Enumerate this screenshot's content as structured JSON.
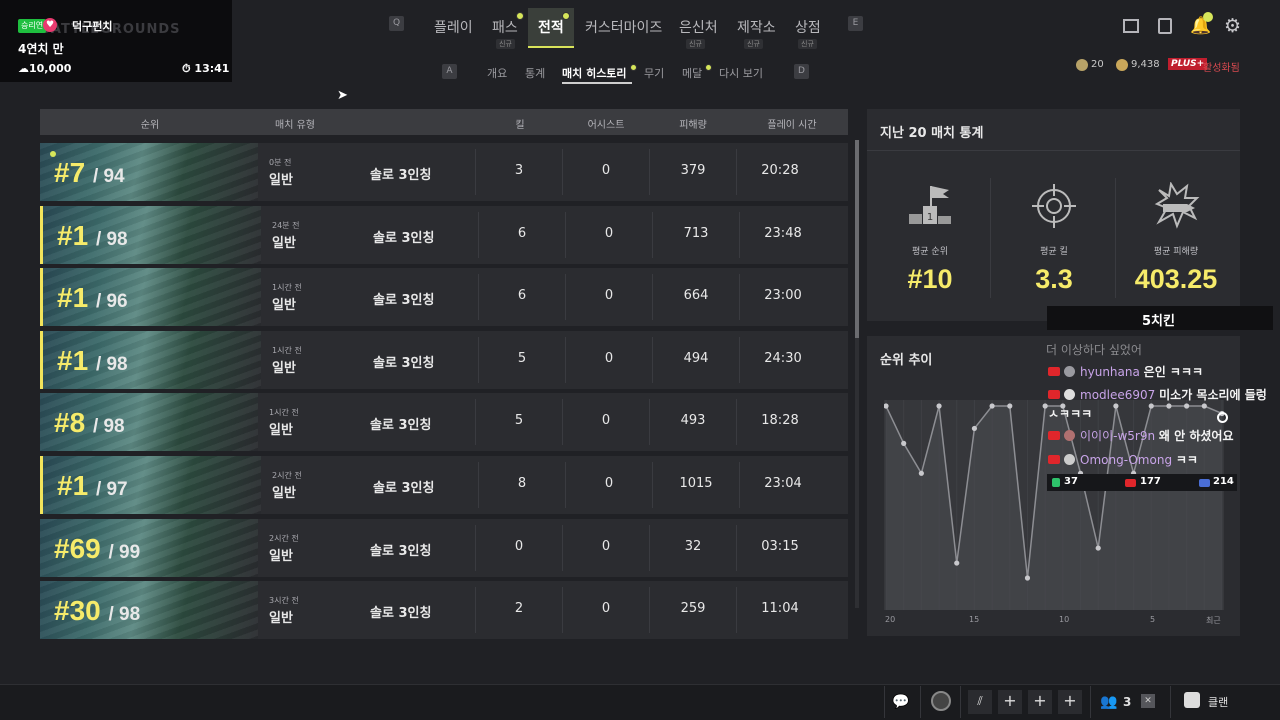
{
  "overlay": {
    "tag": "승리연",
    "name": "덕구펀치",
    "logo": "BATTLEGROUNDS",
    "goal": "4연치 만",
    "amount": "10,000",
    "time": "13:41"
  },
  "nav": {
    "key_left": "Q",
    "key_right": "E",
    "items": [
      {
        "label": "플레이",
        "new": ""
      },
      {
        "label": "패스",
        "new": "신규"
      },
      {
        "label": "전적",
        "new": ""
      },
      {
        "label": "커스터마이즈",
        "new": ""
      },
      {
        "label": "은신처",
        "new": "신규"
      },
      {
        "label": "제작소",
        "new": "신규"
      },
      {
        "label": "상점",
        "new": "신규"
      }
    ]
  },
  "currency": {
    "coins": "20",
    "bp": "9,438",
    "plus_badge": "PLUS+",
    "plus_status": "활성화됨"
  },
  "subnav": {
    "key_left": "A",
    "key_right": "D",
    "items": [
      "개요",
      "통계",
      "매치 히스토리",
      "무기",
      "메달",
      "다시 보기"
    ],
    "active": "매치 히스토리"
  },
  "table": {
    "headers": {
      "rank": "순위",
      "type": "매치 유형",
      "kills": "킬",
      "assists": "어시스트",
      "damage": "피해량",
      "playtime": "플레이 시간"
    },
    "rows": [
      {
        "rank": "#7",
        "total": "/ 94",
        "ago": "0분 전",
        "type": "일반",
        "mode": "솔로 3인칭",
        "kills": "3",
        "assists": "0",
        "damage": "379",
        "time": "20:28",
        "win": false,
        "new": true
      },
      {
        "rank": "#1",
        "total": "/ 98",
        "ago": "24분 전",
        "type": "일반",
        "mode": "솔로 3인칭",
        "kills": "6",
        "assists": "0",
        "damage": "713",
        "time": "23:48",
        "win": true,
        "new": false
      },
      {
        "rank": "#1",
        "total": "/ 96",
        "ago": "1시간 전",
        "type": "일반",
        "mode": "솔로 3인칭",
        "kills": "6",
        "assists": "0",
        "damage": "664",
        "time": "23:00",
        "win": true,
        "new": false
      },
      {
        "rank": "#1",
        "total": "/ 98",
        "ago": "1시간 전",
        "type": "일반",
        "mode": "솔로 3인칭",
        "kills": "5",
        "assists": "0",
        "damage": "494",
        "time": "24:30",
        "win": true,
        "new": false
      },
      {
        "rank": "#8",
        "total": "/ 98",
        "ago": "1시간 전",
        "type": "일반",
        "mode": "솔로 3인칭",
        "kills": "5",
        "assists": "0",
        "damage": "493",
        "time": "18:28",
        "win": false,
        "new": false
      },
      {
        "rank": "#1",
        "total": "/ 97",
        "ago": "2시간 전",
        "type": "일반",
        "mode": "솔로 3인칭",
        "kills": "8",
        "assists": "0",
        "damage": "1015",
        "time": "23:04",
        "win": true,
        "new": false
      },
      {
        "rank": "#69",
        "total": "/ 99",
        "ago": "2시간 전",
        "type": "일반",
        "mode": "솔로 3인칭",
        "kills": "0",
        "assists": "0",
        "damage": "32",
        "time": "03:15",
        "win": false,
        "new": false
      },
      {
        "rank": "#30",
        "total": "/ 98",
        "ago": "3시간 전",
        "type": "일반",
        "mode": "솔로 3인칭",
        "kills": "2",
        "assists": "0",
        "damage": "259",
        "time": "11:04",
        "win": false,
        "new": false
      }
    ]
  },
  "stats": {
    "title": "지난 20 매치 통계",
    "avg_rank_label": "평균 순위",
    "avg_rank": "#10",
    "avg_kills_label": "평균 킬",
    "avg_kills": "3.3",
    "avg_damage_label": "평균 피해량",
    "avg_damage": "403.25"
  },
  "trend": {
    "title": "순위 추이",
    "xticks": [
      "20",
      "15",
      "10",
      "5",
      "최근"
    ]
  },
  "chart_data": {
    "type": "line",
    "title": "순위 추이",
    "x": [
      20,
      19,
      18,
      17,
      16,
      15,
      14,
      13,
      12,
      11,
      10,
      9,
      8,
      7,
      6,
      5,
      4,
      3,
      2,
      1
    ],
    "series": [
      {
        "values": [
          1,
          6,
          10,
          1,
          22,
          4,
          1,
          1,
          24,
          1,
          1,
          10,
          20,
          1,
          10,
          1,
          1,
          1,
          1,
          2
        ]
      }
    ],
    "ylim": [
      1,
      24
    ],
    "grid": true
  },
  "chat": {
    "top_label": "5치킨",
    "partial": "더 이상하다 싶었어",
    "lines": [
      {
        "user": "hyunhana",
        "msg": "은인 ㅋㅋㅋ"
      },
      {
        "user": "modlee6907",
        "msg": "미소가 목소리에 들렁"
      },
      {
        "user": "",
        "msg": "ㅅㅋㅋㅋ"
      },
      {
        "user": "이이이-w5r9n",
        "msg": "왜 안 하셨어요"
      },
      {
        "user": "Omong-Omong",
        "msg": "ㅋㅋ"
      }
    ],
    "counts": {
      "a": "37",
      "b": "177",
      "c": "214"
    }
  },
  "bottom": {
    "party_count": "3",
    "clan": "클랜"
  }
}
